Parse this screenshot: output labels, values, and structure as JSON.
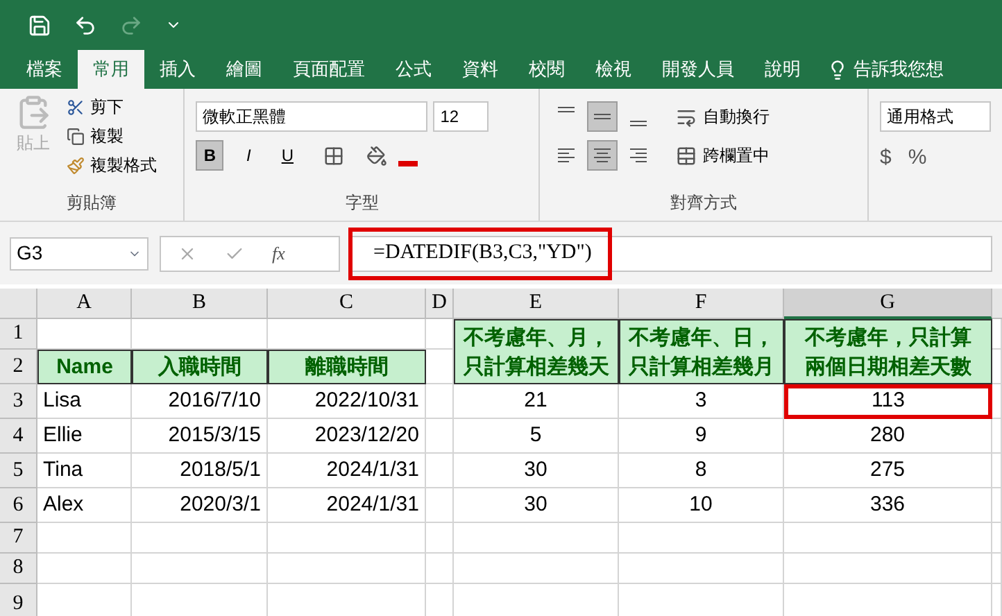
{
  "tabs": [
    {
      "label": "檔案",
      "selected": false
    },
    {
      "label": "常用",
      "selected": true
    },
    {
      "label": "插入",
      "selected": false
    },
    {
      "label": "繪圖",
      "selected": false
    },
    {
      "label": "頁面配置",
      "selected": false
    },
    {
      "label": "公式",
      "selected": false
    },
    {
      "label": "資料",
      "selected": false
    },
    {
      "label": "校閱",
      "selected": false
    },
    {
      "label": "檢視",
      "selected": false
    },
    {
      "label": "開發人員",
      "selected": false
    },
    {
      "label": "說明",
      "selected": false
    }
  ],
  "tell_me": "告訴我您想",
  "clipboard": {
    "paste": "貼上",
    "cut": "剪下",
    "copy": "複製",
    "format_painter": "複製格式",
    "label": "剪貼簿"
  },
  "font": {
    "name": "微軟正黑體",
    "size": "12",
    "label": "字型",
    "style_buttons": [
      {
        "label": "B",
        "selected": true
      },
      {
        "label": "I",
        "selected": false
      },
      {
        "label": "U",
        "selected": false
      }
    ]
  },
  "alignment": {
    "top_buttons": [
      {
        "kind": "top",
        "selected": false
      },
      {
        "kind": "middle",
        "selected": true
      },
      {
        "kind": "bottom",
        "selected": false
      }
    ],
    "bottom_buttons": [
      {
        "kind": "left",
        "selected": false
      },
      {
        "kind": "center",
        "selected": true
      },
      {
        "kind": "right",
        "selected": false
      }
    ],
    "wrap": "自動換行",
    "merge": "跨欄置中",
    "label": "對齊方式"
  },
  "number": {
    "format": "通用格式",
    "currency": "$",
    "percent": "%"
  },
  "formula_bar": {
    "name_box": "G3",
    "fx": "fx",
    "formula": "=DATEDIF(B3,C3,\"YD\")"
  },
  "columns": [
    {
      "label": "A",
      "selected": false
    },
    {
      "label": "B",
      "selected": false
    },
    {
      "label": "C",
      "selected": false
    },
    {
      "label": "D",
      "selected": false
    },
    {
      "label": "E",
      "selected": false
    },
    {
      "label": "F",
      "selected": false
    },
    {
      "label": "G",
      "selected": true
    }
  ],
  "row_numbers": [
    "1",
    "2",
    "3",
    "4",
    "5",
    "6",
    "7",
    "8",
    "9"
  ],
  "headers": [
    "Name",
    "入職時間",
    "離職時間",
    "不考慮年、月，只計算相差幾天",
    "不考慮年、日，只計算相差幾月",
    "不考慮年，只計算兩個日期相差天數"
  ],
  "rows": [
    {
      "name": "Lisa",
      "start": "2016/7/10",
      "end": "2022/10/31",
      "days_no_year_month": "21",
      "months_no_year_day": "3",
      "days_no_year": "113",
      "selected": true
    },
    {
      "name": "Ellie",
      "start": "2015/3/15",
      "end": "2023/12/20",
      "days_no_year_month": "5",
      "months_no_year_day": "9",
      "days_no_year": "280",
      "selected": false
    },
    {
      "name": "Tina",
      "start": "2018/5/1",
      "end": "2024/1/31",
      "days_no_year_month": "30",
      "months_no_year_day": "8",
      "days_no_year": "275",
      "selected": false
    },
    {
      "name": "Alex",
      "start": "2020/3/1",
      "end": "2024/1/31",
      "days_no_year_month": "30",
      "months_no_year_day": "10",
      "days_no_year": "336",
      "selected": false
    }
  ]
}
